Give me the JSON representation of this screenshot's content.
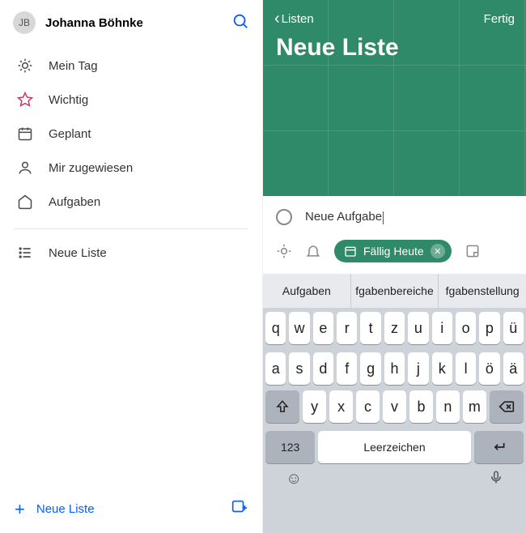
{
  "left": {
    "avatar_initials": "JB",
    "user_name": "Johanna Böhnke",
    "nav": [
      {
        "icon": "sun",
        "label": "Mein Tag"
      },
      {
        "icon": "star",
        "label": "Wichtig"
      },
      {
        "icon": "calendar",
        "label": "Geplant"
      },
      {
        "icon": "person",
        "label": "Mir zugewiesen"
      },
      {
        "icon": "home",
        "label": "Aufgaben"
      }
    ],
    "custom_list_label": "Neue Liste",
    "bottom_new_list": "Neue Liste"
  },
  "right": {
    "back_label": "Listen",
    "done_label": "Fertig",
    "list_title": "Neue Liste",
    "new_task_text": "Neue Aufgabe",
    "due_pill": "Fällig Heute"
  },
  "keyboard": {
    "suggestions": [
      "Aufgaben",
      "fgabenbereiche",
      "fgabenstellung"
    ],
    "row1": [
      "q",
      "w",
      "e",
      "r",
      "t",
      "z",
      "u",
      "i",
      "o",
      "p",
      "ü"
    ],
    "row2": [
      "a",
      "s",
      "d",
      "f",
      "g",
      "h",
      "j",
      "k",
      "l",
      "ö",
      "ä"
    ],
    "row3": [
      "y",
      "x",
      "c",
      "v",
      "b",
      "n",
      "m"
    ],
    "num_key": "123",
    "space_key": "Leerzeichen"
  }
}
